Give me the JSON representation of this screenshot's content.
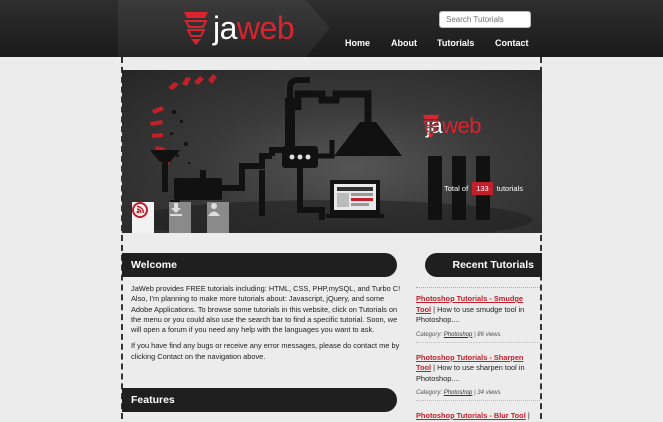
{
  "brand": {
    "name_part1": "ja",
    "name_part2": "web"
  },
  "search": {
    "placeholder": "Search Tutorials"
  },
  "nav": {
    "items": [
      "Home",
      "About",
      "Tutorials",
      "Contact"
    ]
  },
  "banner": {
    "brand_part1": "ja",
    "brand_part2": "web",
    "total_prefix": "Total of",
    "total_count": "133",
    "total_suffix": "tutorials",
    "tiles": [
      "rss-icon",
      "download-icon",
      "user-icon"
    ]
  },
  "welcome": {
    "heading": "Welcome",
    "paragraph1": "JaWeb provides FREE tutorials including: HTML, CSS, PHP,mySQL, and Turbo C! Also, I'm planning to make more tutorials about: Javascript, jQuery, and some Adobe Applications. To browse some tutorials in this website, click on Tutorials on the menu or you could also use the search bar to find a specific tutorial. Soon, we will open a forum if you need any help with the languages you want to ask.",
    "paragraph2": "If you have find any bugs or receive any error messages, please do contact me by clicking Contact on the navigation above."
  },
  "features": {
    "heading": "Features"
  },
  "recent": {
    "heading": "Recent Tutorials",
    "items": [
      {
        "link": "Photoshop Tutorials - Smudge Tool",
        "desc": "| How to use smudge tool in Photoshop....",
        "category_label": "Category:",
        "category": "Photoshop",
        "views": "| 86 views"
      },
      {
        "link": "Photoshop Tutorials - Sharpen Tool",
        "desc": "| How to use sharpen tool in Photoshop....",
        "category_label": "Category:",
        "category": "Photoshop",
        "views": "| 34 views"
      },
      {
        "link": "Photoshop Tutorials - Blur Tool",
        "desc": "|",
        "category_label": "",
        "category": "",
        "views": ""
      }
    ]
  },
  "colors": {
    "accent": "#d9232e",
    "header": "#222222",
    "background": "#ececec"
  }
}
